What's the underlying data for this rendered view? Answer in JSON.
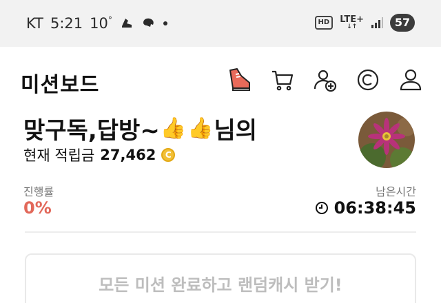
{
  "status_bar": {
    "carrier": "KT",
    "time": "5:21",
    "temperature": "10",
    "temperature_unit": "°",
    "hd": "HD",
    "network": "LTE+",
    "battery": "57"
  },
  "header": {
    "title": "미션보드",
    "icons": [
      "sneaker-icon",
      "cart-icon",
      "add-user-icon",
      "copyright-icon",
      "user-icon"
    ]
  },
  "profile": {
    "name_prefix": "맞구독,답방~",
    "name_suffix": "님의",
    "points_label": "현재 적립금",
    "points_value": "27,462",
    "coin_symbol": "C"
  },
  "progress": {
    "label": "진행률",
    "value": "0%",
    "fraction": 0
  },
  "timer": {
    "label": "남은시간",
    "value": "06:38:45"
  },
  "mission": {
    "text": "모든 미션 완료하고 랜덤캐시 받기!"
  },
  "colors": {
    "accent_red": "#e2685a",
    "coin_gold": "#f2c037"
  }
}
